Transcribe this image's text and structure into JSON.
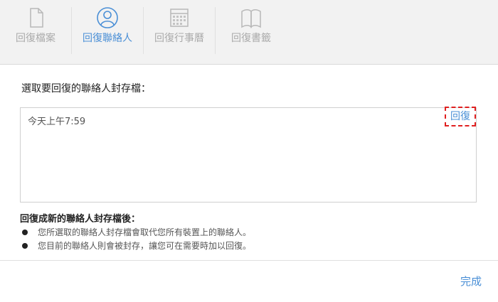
{
  "toolbar": {
    "tabs": [
      {
        "label": "回復檔案",
        "icon": "document-icon"
      },
      {
        "label": "回復聯絡人",
        "icon": "contact-icon"
      },
      {
        "label": "回復行事曆",
        "icon": "calendar-icon"
      },
      {
        "label": "回復書籤",
        "icon": "book-icon"
      }
    ],
    "active_index": 1
  },
  "main": {
    "heading": "選取要回復的聯絡人封存檔：",
    "archives": [
      {
        "time": "今天上午7:59",
        "action": "回復"
      }
    ]
  },
  "notes": {
    "title": "回復成新的聯絡人封存檔後：",
    "items": [
      "您所選取的聯絡人封存檔會取代您所有裝置上的聯絡人。",
      "您目前的聯絡人則會被封存，讓您可在需要時加以回復。"
    ]
  },
  "footer": {
    "done_label": "完成"
  },
  "colors": {
    "accent": "#4a8fd6",
    "highlight": "#e02020",
    "inactive": "#aaaaaa"
  }
}
